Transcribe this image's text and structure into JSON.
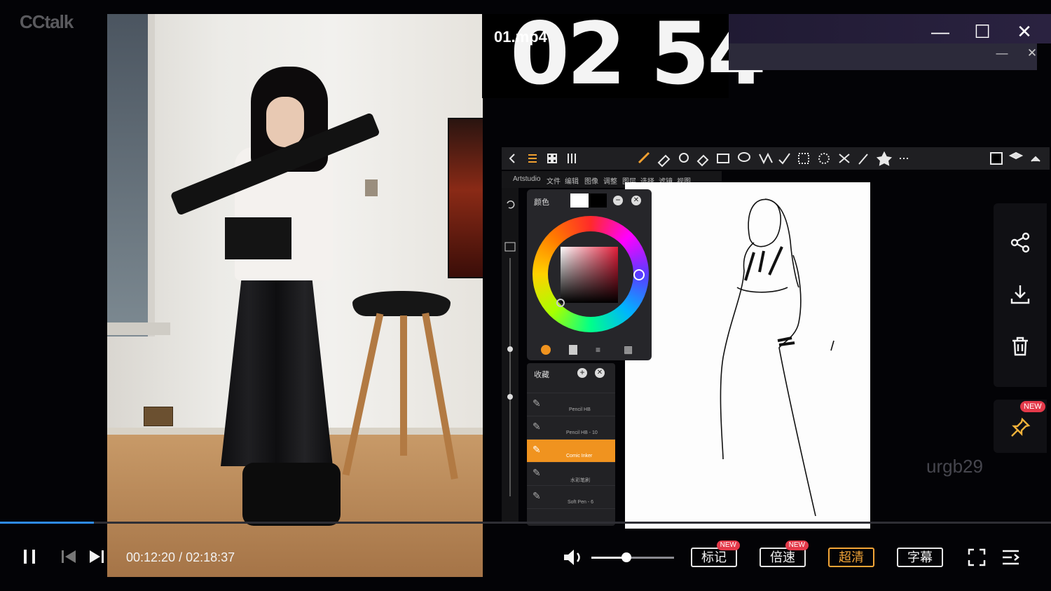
{
  "brand": "CCtalk",
  "video": {
    "filename": "01.mp4",
    "overlay_number": "02 54",
    "watermark": "urgb29"
  },
  "drawing_app": {
    "menu": [
      "Artstudio",
      "文件",
      "编辑",
      "图像",
      "调整",
      "图层",
      "选择",
      "滤镜",
      "视图"
    ],
    "color_panel_title": "颜色",
    "brush_panel_title": "收藏",
    "brushes": [
      "Pencil HB",
      "Pencil HB - 10",
      "Comic Inker",
      "水彩笔刷",
      "Soft Pen - 6"
    ]
  },
  "side_actions": [
    "share-icon",
    "download-icon",
    "delete-icon",
    "pin-icon"
  ],
  "side_new_badge": "NEW",
  "player": {
    "current_time": "00:12:20",
    "separator": "/",
    "total_time": "02:18:37",
    "progress": 0.089,
    "volume": 0.42,
    "buttons": {
      "mark": "标记",
      "speed": "倍速",
      "quality": "超清",
      "subtitle": "字幕"
    },
    "new_badge": "NEW"
  }
}
